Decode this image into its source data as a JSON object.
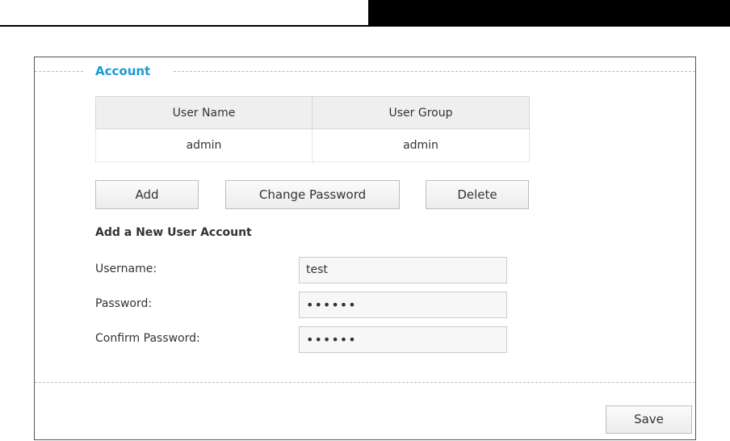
{
  "section": {
    "title": "Account"
  },
  "table": {
    "headers": [
      "User Name",
      "User Group"
    ],
    "rows": [
      [
        "admin",
        "admin"
      ]
    ]
  },
  "actions": {
    "add": "Add",
    "change_password": "Change Password",
    "delete": "Delete"
  },
  "form": {
    "title": "Add a New User Account",
    "username_label": "Username:",
    "username_value": "test",
    "password_label": "Password:",
    "password_value": "••••••",
    "confirm_label": "Confirm Password:",
    "confirm_value": "••••••"
  },
  "footer": {
    "save": "Save"
  },
  "colors": {
    "accent": "#1a9ad6"
  }
}
